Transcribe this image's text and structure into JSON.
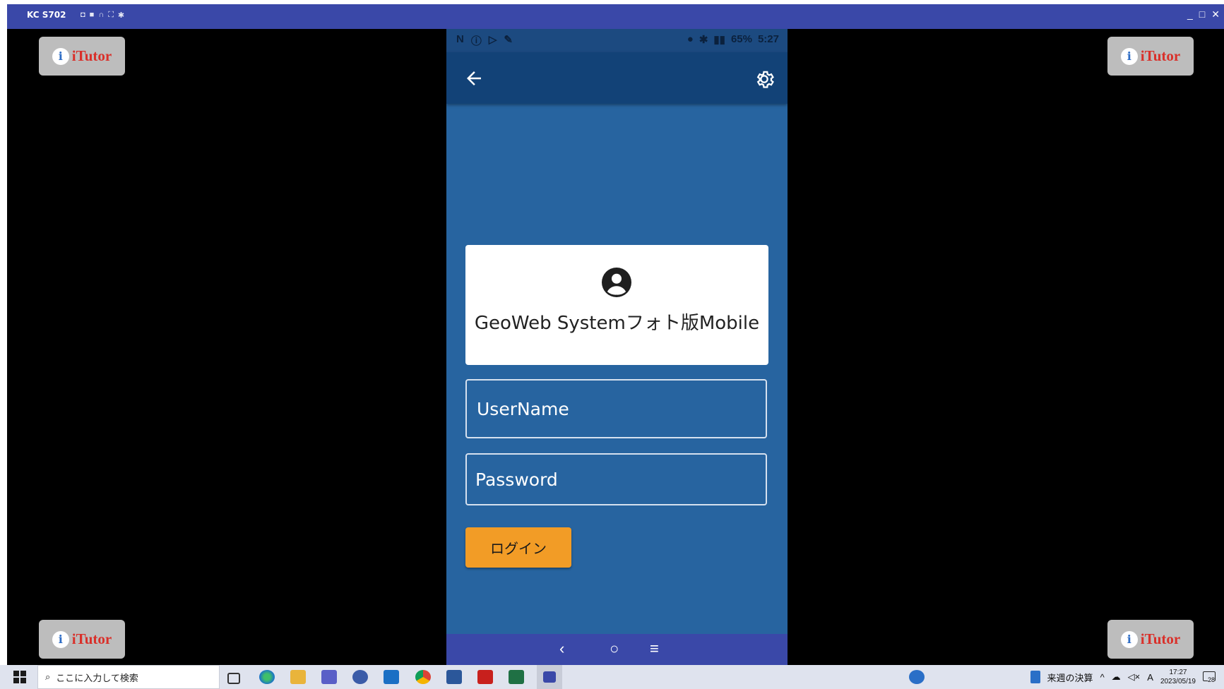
{
  "window": {
    "title": "KC S702",
    "toolbar_icons": [
      "camera-icon",
      "video-icon",
      "headset-icon",
      "fullscreen-icon",
      "settings-icon"
    ],
    "controls": [
      "_",
      "□",
      "✕"
    ]
  },
  "watermark": {
    "text": "iTutor",
    "mark": "i"
  },
  "phone": {
    "statusbar": {
      "battery": "65%",
      "time": "5:27"
    },
    "app": {
      "title": "GeoWeb Systemフォト版Mobile",
      "username_placeholder": "UserName",
      "password_placeholder": "Password",
      "login_label": "ログイン"
    },
    "nav": {
      "back": "‹",
      "home": "○",
      "menu": "≡"
    }
  },
  "taskbar": {
    "search_placeholder": "ここに入力して検索",
    "tray_app_label": "来週の決算",
    "ime": "A",
    "time": "17:27",
    "date": "2023/05/19",
    "notifications": "28"
  },
  "colors": {
    "titlebar": "#3a48a8",
    "app_bg": "#2764a0",
    "appbar": "#124277",
    "login": "#f29c26",
    "brand_red": "#d9302a"
  }
}
